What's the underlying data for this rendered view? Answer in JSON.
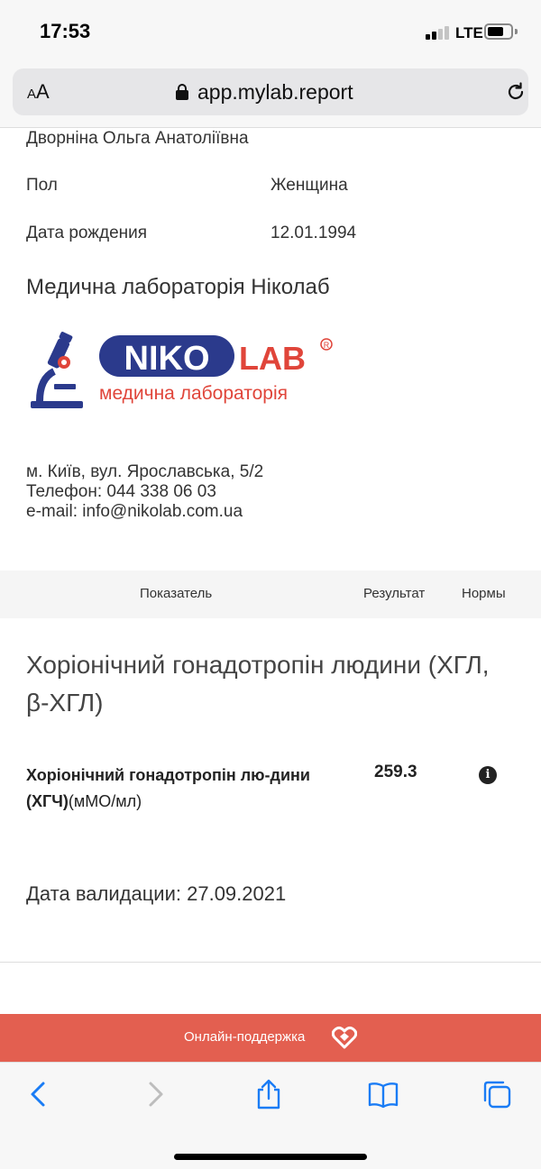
{
  "status_bar": {
    "time": "17:53",
    "network": "LTE"
  },
  "browser": {
    "text_size_label_small": "A",
    "text_size_label_large": "A",
    "url": "app.mylab.report"
  },
  "patient": {
    "name": "Дворніна Ольга Анатоліївна",
    "rows": [
      {
        "label": "Пол",
        "value": "Женщина"
      },
      {
        "label": "Дата рождения",
        "value": "12.01.1994"
      }
    ]
  },
  "lab": {
    "title": "Медична лабораторія Ніколаб",
    "logo_text": "NIKO LAB",
    "logo_subtitle": "медична лабораторія",
    "address": "м. Київ, вул. Ярославська, 5/2",
    "phone": "Телефон: 044 338 06 03",
    "email": "e-mail: info@nikolab.com.ua"
  },
  "table": {
    "headers": {
      "indicator": "Показатель",
      "result": "Результат",
      "norms": "Нормы"
    }
  },
  "test": {
    "section_title": "Хоріонічний гонадотропін людини (ХГЛ, β-ХГЛ)",
    "indicator_name": "Хоріонічний гонадотропін лю-дини (ХГЧ)",
    "indicator_unit": "(мМО/мл)",
    "result": "259.3",
    "validation_date": "Дата валидации: 27.09.2021"
  },
  "support": {
    "label": "Онлайн-поддержка"
  },
  "colors": {
    "support_bar": "#e35f50",
    "logo_blue": "#2b3a8c",
    "logo_red": "#e0453a",
    "toolbar_blue": "#1a7cf5"
  },
  "icons": {
    "back": "chevron-left-icon",
    "forward": "chevron-right-icon",
    "share": "share-icon",
    "bookmarks": "book-icon",
    "tabs": "tabs-icon",
    "info": "info-icon",
    "reload": "reload-icon",
    "lock": "lock-icon"
  }
}
